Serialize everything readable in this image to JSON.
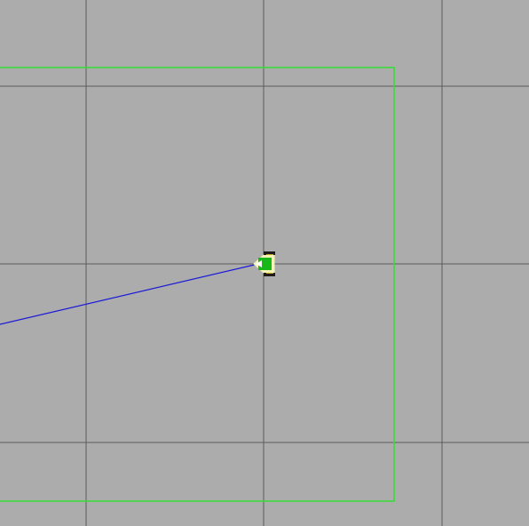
{
  "scene": {
    "background_color": "#acacac",
    "grid_line_color": "#5c5c5c",
    "boundary_color": "#33dd33",
    "path_color": "#1a1ad8",
    "robot_body_color": "#18b818",
    "robot_outline_color": "#f3f3b8",
    "robot_wheel_color": "#1c1c1c",
    "robot_wheel_accent_color": "#c8a61c",
    "robot_direction_color": "#ffffff"
  },
  "icons": {
    "robot": "mobile-robot-icon",
    "path": "planned-path-line",
    "boundary": "workspace-boundary-rectangle"
  }
}
